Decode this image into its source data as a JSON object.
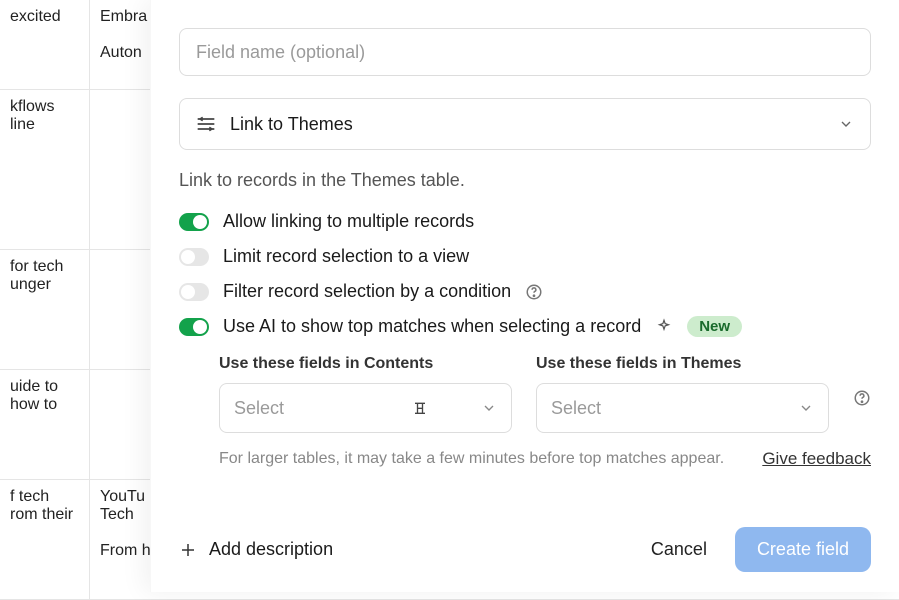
{
  "bg_rows": [
    {
      "c0": "excited",
      "c1": "Embra\n\nAuton"
    },
    {
      "c0": "kflows\nline",
      "c1": ""
    },
    {
      "c0": "for tech\nunger",
      "c1": ""
    },
    {
      "c0": "uide to\nhow to",
      "c1": ""
    },
    {
      "c0": "f tech\nrom their",
      "c1": "YouTu\nTech\n\nFrom humble beginnings ..."
    }
  ],
  "dialog": {
    "field_name_placeholder": "Field name (optional)",
    "type_label": "Link to Themes",
    "helper": "Link to records in the Themes table.",
    "toggles": {
      "allow_multiple": {
        "label": "Allow linking to multiple records",
        "on": true
      },
      "limit_view": {
        "label": "Limit record selection to a view",
        "on": false
      },
      "filter_cond": {
        "label": "Filter record selection by a condition",
        "on": false
      },
      "ai_top": {
        "label": "Use AI to show top matches when selecting a record",
        "on": true,
        "badge": "New"
      }
    },
    "ai": {
      "left_label": "Use these fields in Contents",
      "right_label": "Use these fields in Themes",
      "select_placeholder": "Select",
      "hint": "For larger tables, it may take a few minutes before top matches appear.",
      "feedback": "Give feedback"
    },
    "add_desc": "Add description",
    "cancel": "Cancel",
    "create": "Create field"
  }
}
